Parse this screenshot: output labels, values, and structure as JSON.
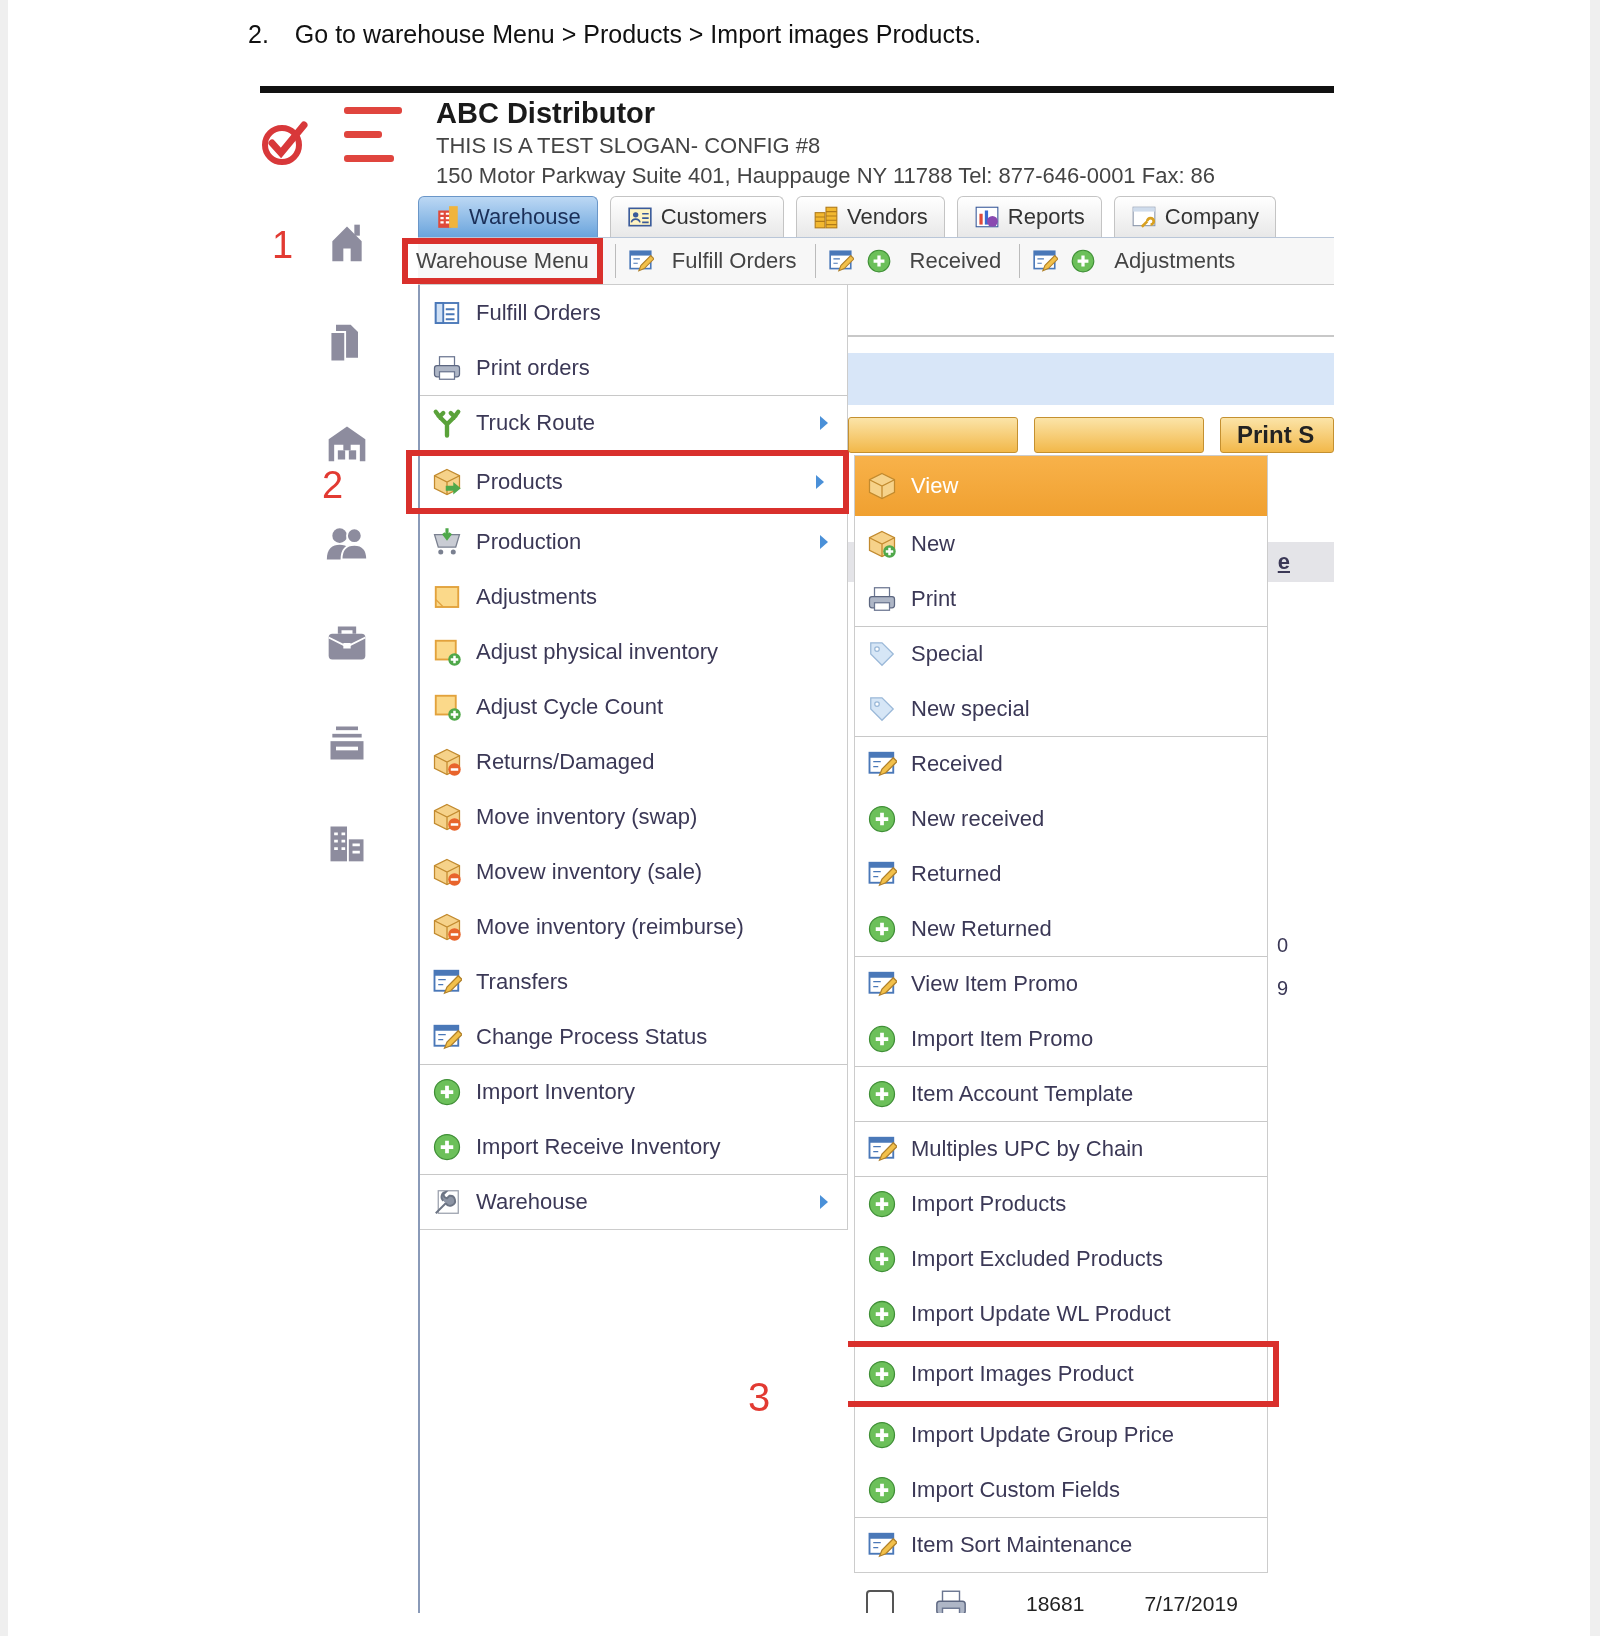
{
  "instruction": {
    "number": "2.",
    "text": "Go to warehouse Menu > Products > Import images Products."
  },
  "header": {
    "company": "ABC Distributor",
    "slogan": "THIS IS A TEST SLOGAN- CONFIG #8",
    "address": "150 Motor Parkway Suite 401, Hauppauge NY 11788 Tel: 877-646-0001 Fax: 86"
  },
  "sidebar": [
    {
      "kind": "home",
      "step": "1"
    },
    {
      "kind": "documents"
    },
    {
      "kind": "warehouse",
      "step": "2"
    },
    {
      "kind": "people"
    },
    {
      "kind": "briefcase"
    },
    {
      "kind": "archive"
    },
    {
      "kind": "buildings"
    }
  ],
  "tabs": [
    {
      "label": "Warehouse",
      "kind": "building",
      "selected": true
    },
    {
      "label": "Customers",
      "kind": "card",
      "selected": false
    },
    {
      "label": "Vendors",
      "kind": "coins",
      "selected": false
    },
    {
      "label": "Reports",
      "kind": "chart",
      "selected": false
    },
    {
      "label": "Company",
      "kind": "window",
      "selected": false
    }
  ],
  "toolbar": [
    {
      "label": "Warehouse Menu",
      "kind": "text",
      "annotated": true
    },
    {
      "label": "Fulfill Orders",
      "kind": "edit",
      "annotated": false
    },
    {
      "label": "Received",
      "kind": "edit-plus",
      "annotated": false
    },
    {
      "label": "Adjustments",
      "kind": "edit-plus",
      "annotated": false
    }
  ],
  "menu": [
    {
      "label": "Fulfill Orders",
      "kind": "list",
      "separator_before": false,
      "has_submenu": false,
      "annotated": false
    },
    {
      "label": "Print orders",
      "kind": "printer",
      "separator_before": false,
      "has_submenu": false,
      "annotated": false
    },
    {
      "label": "Truck Route",
      "kind": "fork",
      "separator_before": true,
      "has_submenu": true,
      "annotated": false
    },
    {
      "label": "Products",
      "kind": "box-arrow",
      "separator_before": false,
      "has_submenu": true,
      "annotated": true
    },
    {
      "label": "Production",
      "kind": "cart",
      "separator_before": false,
      "has_submenu": true,
      "annotated": false
    },
    {
      "label": "Adjustments",
      "kind": "note",
      "separator_before": false,
      "has_submenu": false,
      "annotated": false
    },
    {
      "label": "Adjust physical inventory",
      "kind": "note-plus",
      "separator_before": false,
      "has_submenu": false,
      "annotated": false
    },
    {
      "label": "Adjust Cycle Count",
      "kind": "note-plus",
      "separator_before": false,
      "has_submenu": false,
      "annotated": false
    },
    {
      "label": "Returns/Damaged",
      "kind": "box-minus",
      "separator_before": false,
      "has_submenu": false,
      "annotated": false
    },
    {
      "label": "Move inventory (swap)",
      "kind": "box-minus",
      "separator_before": false,
      "has_submenu": false,
      "annotated": false
    },
    {
      "label": "Movew inventory (sale)",
      "kind": "box-minus",
      "separator_before": false,
      "has_submenu": false,
      "annotated": false
    },
    {
      "label": "Move inventory (reimburse)",
      "kind": "box-minus",
      "separator_before": false,
      "has_submenu": false,
      "annotated": false
    },
    {
      "label": "Transfers",
      "kind": "edit",
      "separator_before": false,
      "has_submenu": false,
      "annotated": false
    },
    {
      "label": "Change Process Status",
      "kind": "edit",
      "separator_before": false,
      "has_submenu": false,
      "annotated": false
    },
    {
      "label": "Import Inventory",
      "kind": "plus",
      "separator_before": true,
      "has_submenu": false,
      "annotated": false
    },
    {
      "label": "Import Receive Inventory",
      "kind": "plus",
      "separator_before": false,
      "has_submenu": false,
      "annotated": false
    },
    {
      "label": "Warehouse",
      "kind": "wrench",
      "separator_before": true,
      "has_submenu": true,
      "annotated": false
    }
  ],
  "submenu": [
    {
      "label": "View",
      "kind": "box",
      "selected": true,
      "separator_before": false,
      "annotated": false
    },
    {
      "label": "New",
      "kind": "box-plus",
      "selected": false,
      "separator_before": false,
      "annotated": false
    },
    {
      "label": "Print",
      "kind": "printer",
      "selected": false,
      "separator_before": false,
      "annotated": false
    },
    {
      "label": "Special",
      "kind": "tag",
      "selected": false,
      "separator_before": true,
      "annotated": false
    },
    {
      "label": "New special",
      "kind": "tag",
      "selected": false,
      "separator_before": false,
      "annotated": false
    },
    {
      "label": "Received",
      "kind": "edit",
      "selected": false,
      "separator_before": true,
      "annotated": false
    },
    {
      "label": "New received",
      "kind": "plus",
      "selected": false,
      "separator_before": false,
      "annotated": false
    },
    {
      "label": "Returned",
      "kind": "edit",
      "selected": false,
      "separator_before": false,
      "annotated": false
    },
    {
      "label": "New Returned",
      "kind": "plus",
      "selected": false,
      "separator_before": false,
      "annotated": false
    },
    {
      "label": "View Item Promo",
      "kind": "edit",
      "selected": false,
      "separator_before": true,
      "annotated": false
    },
    {
      "label": "Import Item Promo",
      "kind": "plus",
      "selected": false,
      "separator_before": false,
      "annotated": false
    },
    {
      "label": "Item Account Template",
      "kind": "plus",
      "selected": false,
      "separator_before": true,
      "annotated": false
    },
    {
      "label": "Multiples UPC by Chain",
      "kind": "edit",
      "selected": false,
      "separator_before": true,
      "annotated": false
    },
    {
      "label": "Import Products",
      "kind": "plus",
      "selected": false,
      "separator_before": true,
      "annotated": false
    },
    {
      "label": "Import Excluded Products",
      "kind": "plus",
      "selected": false,
      "separator_before": false,
      "annotated": false
    },
    {
      "label": "Import Update WL Product",
      "kind": "plus",
      "selected": false,
      "separator_before": false,
      "annotated": false
    },
    {
      "label": "Import Images Product",
      "kind": "plus",
      "selected": false,
      "separator_before": false,
      "annotated": true,
      "step": "3"
    },
    {
      "label": "Import Update Group Price",
      "kind": "plus",
      "selected": false,
      "separator_before": false,
      "annotated": false
    },
    {
      "label": "Import Custom Fields",
      "kind": "plus",
      "selected": false,
      "separator_before": false,
      "annotated": false
    },
    {
      "label": "Item Sort Maintenance",
      "kind": "edit",
      "selected": false,
      "separator_before": true,
      "annotated": false
    }
  ],
  "content": {
    "button_3": "Print S",
    "column_header": "e",
    "cell_1": "0",
    "cell_2": "9",
    "row": {
      "checked": false,
      "number": "18681",
      "date": "7/17/2019"
    }
  }
}
